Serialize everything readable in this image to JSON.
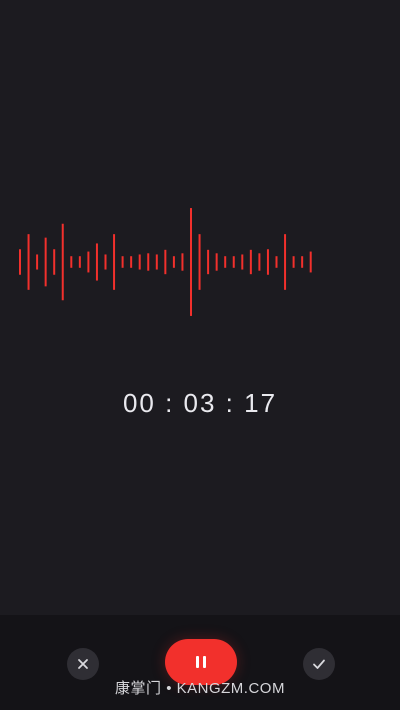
{
  "timer": {
    "display": "00 : 03 : 17",
    "hours": "00",
    "minutes": "03",
    "seconds": "17"
  },
  "waveform": {
    "color": "#f2302c",
    "levels": [
      0.22,
      0.48,
      0.13,
      0.42,
      0.22,
      0.66,
      0.1,
      0.1,
      0.18,
      0.32,
      0.13,
      0.48,
      0.1,
      0.1,
      0.13,
      0.15,
      0.13,
      0.21,
      0.1,
      0.15,
      0.93,
      0.48,
      0.21,
      0.15,
      0.1,
      0.1,
      0.13,
      0.21,
      0.15,
      0.22,
      0.1,
      0.48,
      0.1,
      0.1,
      0.18
    ]
  },
  "controls": {
    "cancel_icon": "close-icon",
    "pause_icon": "pause-icon",
    "confirm_icon": "check-icon",
    "accent_color": "#f2302c"
  },
  "watermark": {
    "text": "康掌门 • KANGZM.COM"
  }
}
